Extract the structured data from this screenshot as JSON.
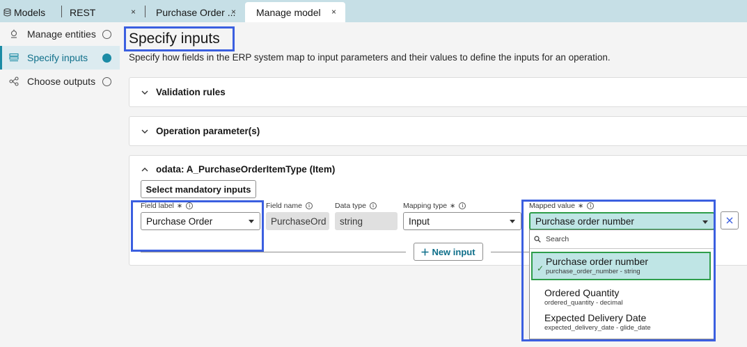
{
  "tabs": {
    "models": "Models",
    "rest": "REST",
    "purchase_order": "Purchase Order ...",
    "manage_model": "Manage model",
    "close_glyph": "×"
  },
  "sidebar": {
    "items": [
      {
        "label": "Manage entities",
        "icon": "entities-icon",
        "state": "empty"
      },
      {
        "label": "Specify inputs",
        "icon": "inputs-icon",
        "state": "active"
      },
      {
        "label": "Choose outputs",
        "icon": "outputs-icon",
        "state": "empty"
      }
    ]
  },
  "main": {
    "title": "Specify inputs",
    "subtitle": "Specify how fields in the ERP system map to input parameters and their values to define the inputs for an operation.",
    "panels": {
      "validation": "Validation rules",
      "operation": "Operation parameter(s)",
      "entity": "odata: A_PurchaseOrderItemType (Item)"
    },
    "select_mandatory": "Select mandatory inputs",
    "fields": {
      "field_label": {
        "label": "Field label",
        "value": "Purchase Order"
      },
      "field_name": {
        "label": "Field name",
        "value": "PurchaseOrd"
      },
      "data_type": {
        "label": "Data type",
        "value": "string"
      },
      "mapping_type": {
        "label": "Mapping type",
        "value": "Input"
      },
      "mapped_value": {
        "label": "Mapped value",
        "value": "Purchase order number"
      }
    },
    "required_mark": "∗",
    "info_glyph": "i",
    "new_input": "New input",
    "dropdown": {
      "search_placeholder": "Search",
      "options": [
        {
          "label": "Purchase order number",
          "detail": "purchase_order_number - string",
          "selected": true
        },
        {
          "label": "Ordered Quantity",
          "detail": "ordered_quantity - decimal",
          "selected": false
        },
        {
          "label": "Expected Delivery Date",
          "detail": "expected_delivery_date - glide_date",
          "selected": false
        }
      ]
    }
  },
  "colors": {
    "accent": "#1b8ba5",
    "highlight": "#3b5fe0",
    "selected_border": "#2e9d4a",
    "selected_bg": "#bfe5e5"
  }
}
